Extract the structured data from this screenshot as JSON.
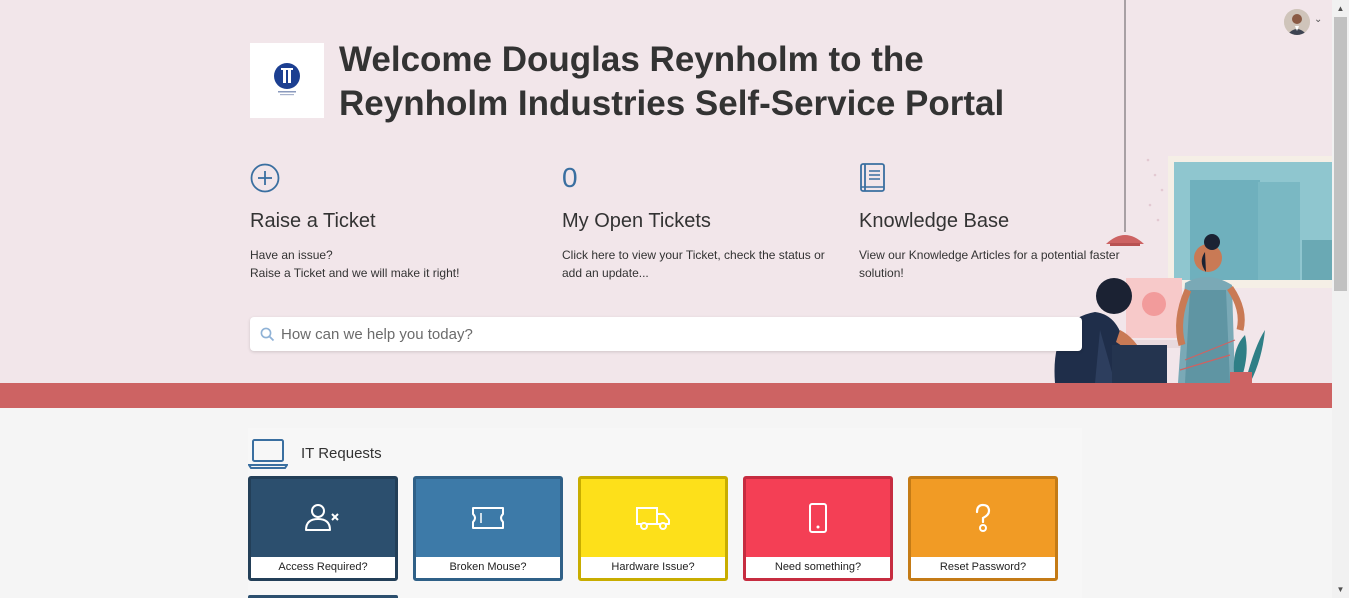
{
  "header": {
    "welcome_line1": "Welcome Douglas Reynholm to the",
    "welcome_line2": "Reynholm Industries Self-Service Portal",
    "logo_icon": "reynholm-logo",
    "user_avatar_icon": "user-avatar",
    "caret_icon": "chevron-down-icon"
  },
  "features": [
    {
      "icon": "plus-circle-icon",
      "title": "Raise a Ticket",
      "line1": "Have an issue?",
      "line2": "Raise a Ticket and we will make it right!"
    },
    {
      "count": "0",
      "title": "My Open Tickets",
      "line1": "Click here to view your Ticket, check the status or",
      "line2": "add an update..."
    },
    {
      "icon": "book-icon",
      "title": "Knowledge Base",
      "line1": "View our Knowledge Articles for a potential faster",
      "line2": "solution!"
    }
  ],
  "search": {
    "placeholder": "How can we help you today?",
    "value": ""
  },
  "it_requests": {
    "title": "IT Requests",
    "tiles": [
      {
        "label": "Access Required?",
        "icon": "user-remove-icon",
        "color": "#2c4f6e",
        "border": "#233f58"
      },
      {
        "label": "Broken Mouse?",
        "icon": "ticket-icon",
        "color": "#3d7aa8",
        "border": "#2f6087"
      },
      {
        "label": "Hardware Issue?",
        "icon": "truck-icon",
        "color": "#fde01a",
        "border": "#c8ad00"
      },
      {
        "label": "Need something?",
        "icon": "mobile-icon",
        "color": "#f43f55",
        "border": "#c62c40"
      },
      {
        "label": "Reset Password?",
        "icon": "question-icon",
        "color": "#f19b25",
        "border": "#c47b16"
      }
    ]
  },
  "colors": {
    "hero_bg": "#f2e6ea",
    "band": "#cd6363",
    "accent_blue": "#3a6fa0"
  }
}
